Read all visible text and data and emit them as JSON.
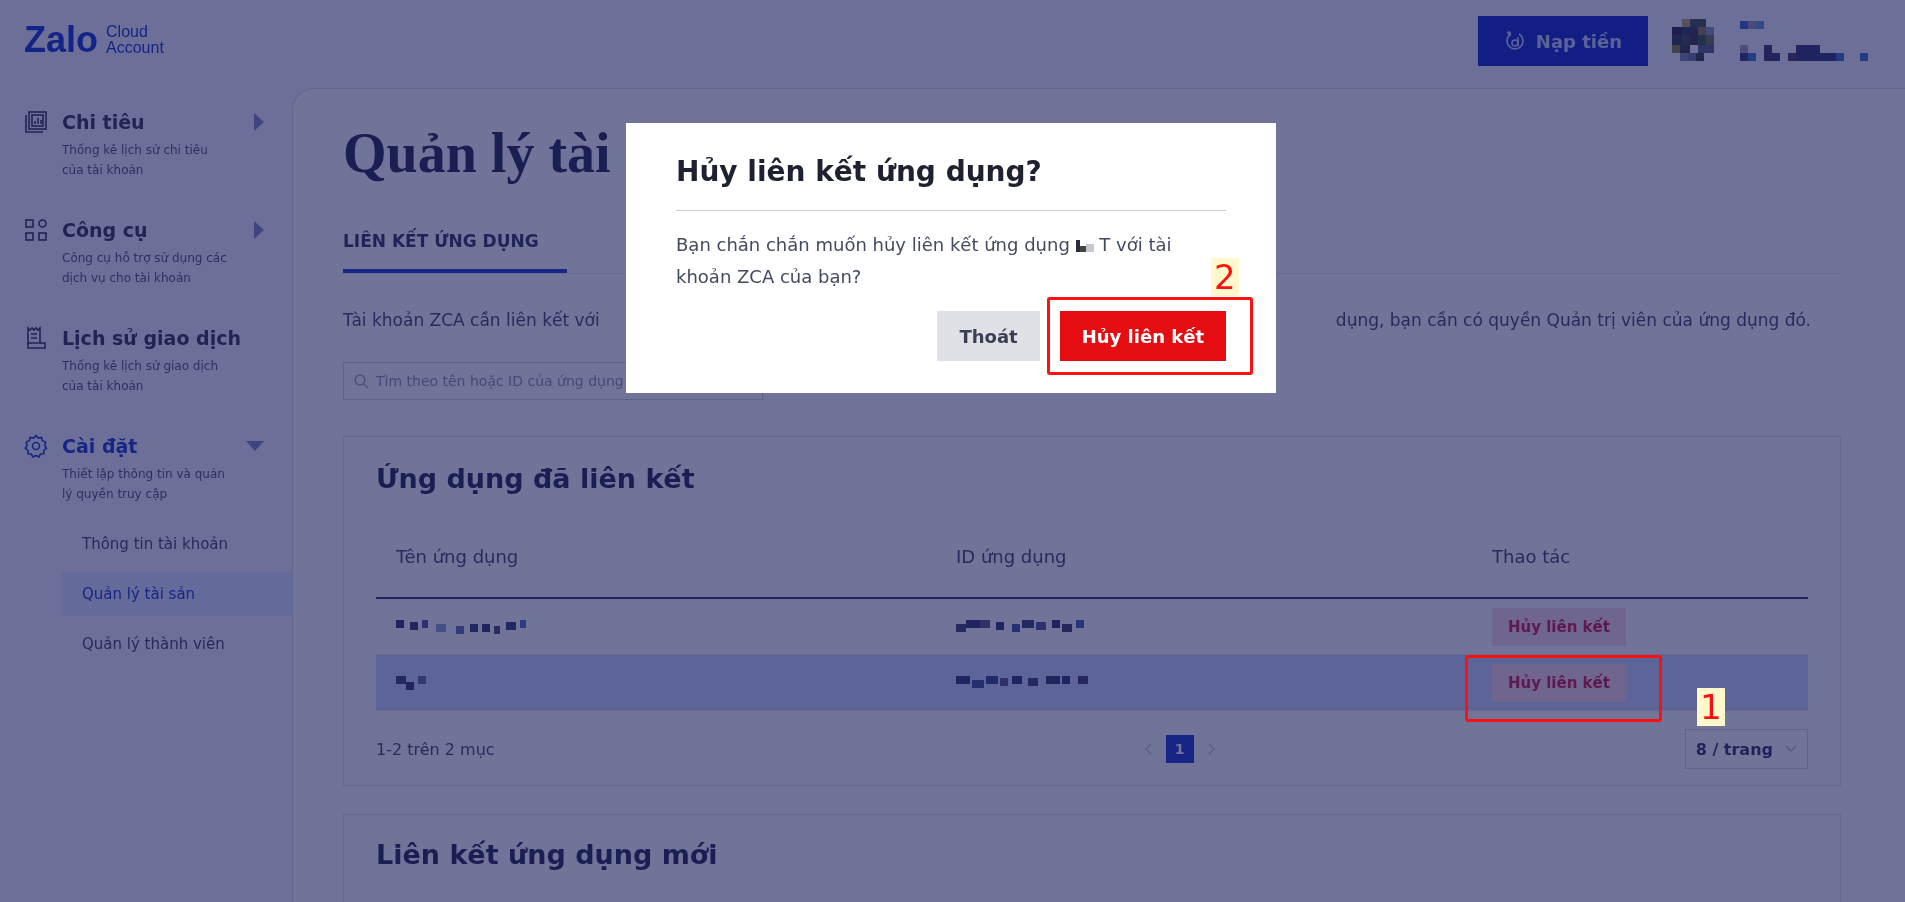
{
  "header": {
    "logo": {
      "brand": "Zalo",
      "line1": "Cloud",
      "line2": "Account"
    },
    "topup_button": "Nạp tiền"
  },
  "sidebar": {
    "items": [
      {
        "kind": "spending",
        "title": "Chi tiêu",
        "description": "Thống kê lịch sử chi tiêu của tài khoản",
        "expanded": false,
        "has_caret": true
      },
      {
        "kind": "tools",
        "title": "Công cụ",
        "description": "Công cụ hỗ trợ sử dụng các dịch vụ cho tài khoản",
        "expanded": false,
        "has_caret": true
      },
      {
        "kind": "history",
        "title": "Lịch sử giao dịch",
        "description": "Thống kê lịch sử giao dịch của tài khoản",
        "expanded": false,
        "has_caret": false
      },
      {
        "kind": "settings",
        "title": "Cài đặt",
        "description": "Thiết lập thông tin và quản lý quyền truy cập",
        "expanded": true,
        "has_caret": true,
        "children": [
          {
            "label": "Thông tin tài khoản",
            "selected": false
          },
          {
            "label": "Quản lý tài sản",
            "selected": true
          },
          {
            "label": "Quản lý thành viên",
            "selected": false
          }
        ]
      }
    ]
  },
  "main": {
    "title": "Quản lý tài",
    "tabs": [
      {
        "label": "LIÊN KẾT ỨNG DỤNG",
        "selected": true
      }
    ],
    "description_parts": [
      "Tài khoản ZCA cần liên kết với",
      "dụng, bạn cần có quyền Quản trị viên của ứng dụng đó."
    ],
    "search": {
      "placeholder": "Tìm theo tên hoặc ID của ứng dụng"
    },
    "linked_apps": {
      "title": "Ứng dụng đã liên kết",
      "columns": [
        "Tên ứng dụng",
        "ID ứng dụng",
        "Thao tác"
      ],
      "rows": [
        {
          "action": "Hủy liên kết",
          "highlighted": false
        },
        {
          "action": "Hủy liên kết",
          "highlighted": true
        }
      ],
      "summary": "1-2 trên 2 mục",
      "pages": [
        {
          "label": "1",
          "selected": true
        }
      ],
      "page_size": "8 / trang"
    },
    "new_link": {
      "title": "Liên kết ứng dụng mới"
    }
  },
  "dialog": {
    "title": "Hủy liên kết ứng dụng?",
    "message_before": "Bạn chắn chắn muốn hủy liên kết ứng dụng",
    "message_after": "T với tài khoản ZCA của bạn?",
    "buttons": [
      {
        "label": "Thoát",
        "kind": "secondary"
      },
      {
        "label": "Hủy liên kết",
        "kind": "danger"
      }
    ]
  },
  "annotations": [
    {
      "label": "1"
    },
    {
      "label": "2"
    }
  ]
}
